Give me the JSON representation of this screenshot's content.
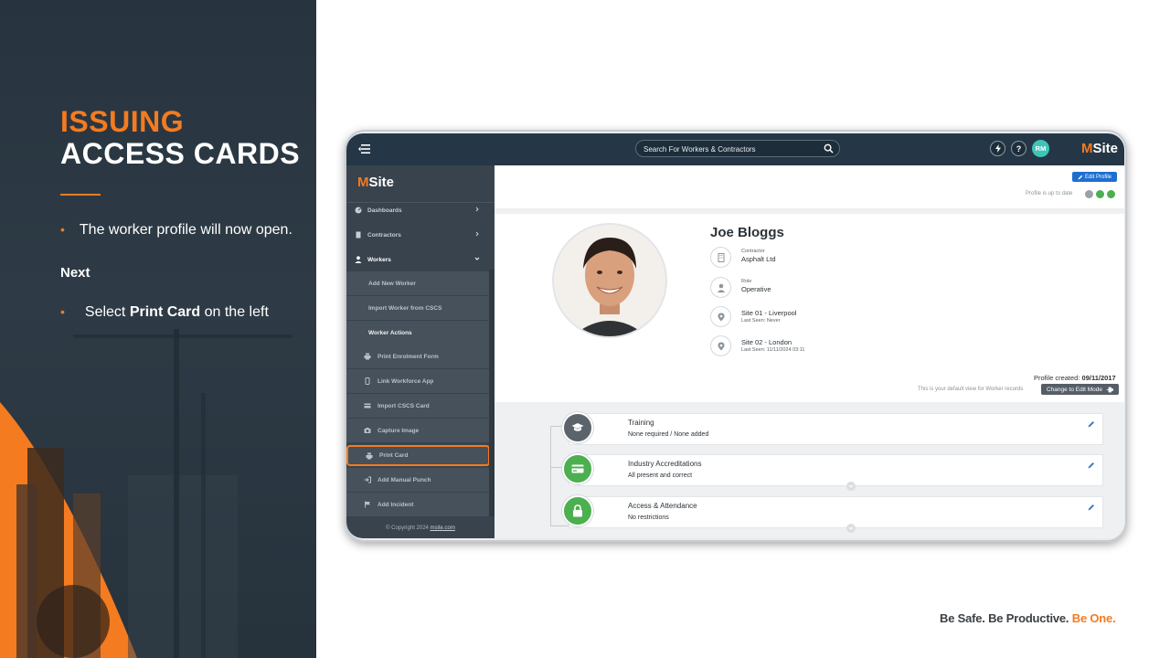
{
  "slide": {
    "title_line1": "ISSUING",
    "title_line2": "ACCESS CARDS",
    "bullet1": "The worker profile will now open.",
    "next_label": "Next",
    "bullet2_prefix": "Select ",
    "bullet2_bold": "Print Card",
    "bullet2_suffix": " on the left",
    "tagline_part1": "Be Safe. Be Productive. ",
    "tagline_part2": "Be One."
  },
  "topbar": {
    "search_placeholder": "Search For Workers & Contractors",
    "help_label": "?",
    "user_initials": "RM",
    "brand_m": "M",
    "brand_rest": "Site"
  },
  "sidebar": {
    "logo_m": "M",
    "logo_rest": "Site",
    "dashboards": "Dashboards",
    "contractors": "Contractors",
    "workers": "Workers",
    "add_new_worker": "Add New Worker",
    "import_worker": "Import Worker from CSCS",
    "worker_actions": "Worker Actions",
    "print_enrolment": "Print Enrolment Form",
    "link_workforce": "Link Workforce App",
    "import_cscs": "Import CSCS Card",
    "capture_image": "Capture Image",
    "print_card": "Print Card",
    "add_manual_punch": "Add Manual Punch",
    "add_incident": "Add Incident",
    "copyright_prefix": "© Copyright 2024 ",
    "copyright_link": "msite.com"
  },
  "profile": {
    "edit_profile": "Edit Profile",
    "status_text": "Profile is up to date",
    "name": "Joe Bloggs",
    "contractor_label": "Contractor",
    "contractor_value": "Asphalt Ltd",
    "role_label": "Role",
    "role_value": "Operative",
    "site1_name": "Site 01 - Liverpool",
    "site1_seen": "Last Seen: Never",
    "site2_name": "Site 02 - London",
    "site2_seen": "Last Seen: 11/11/2024 03:11",
    "created_label": "Profile created: ",
    "created_date": "09/11/2017",
    "default_view": "This is your default view for Worker records",
    "edit_mode": "Change to Edit Mode"
  },
  "sections": {
    "training_title": "Training",
    "training_desc": "None required / None added",
    "accred_title": "Industry Accreditations",
    "accred_desc": "All present and correct",
    "access_title": "Access & Attendance",
    "access_desc": "No restrictions"
  },
  "colors": {
    "accent": "#f47b20",
    "navy": "#253746",
    "sidebar": "#38434d",
    "success": "#4caf50",
    "primary_button": "#1f6fd0"
  }
}
